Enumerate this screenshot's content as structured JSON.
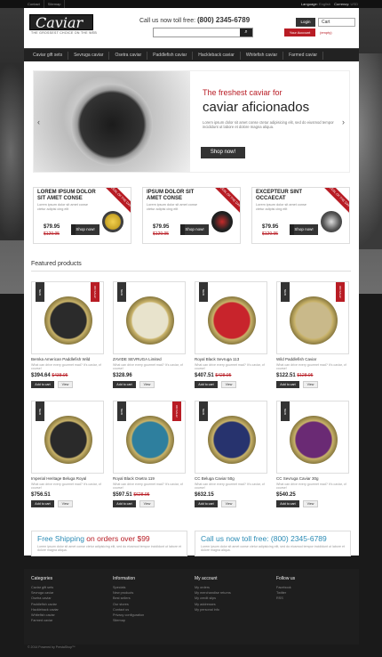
{
  "topbar": {
    "links": [
      "Contact",
      "Sitemap"
    ],
    "language_label": "Language:",
    "language_value": "English",
    "currency_label": "Currency:",
    "currency_value": "USD"
  },
  "header": {
    "logo_text": "Caviar",
    "logo_tagline": "THE GROSSEST CHOICE ON THE WEB",
    "call_label": "Call us now toll free:",
    "call_number": "(800) 2345-6789",
    "search_placeholder": "",
    "login_label": "Login",
    "my_account_label": "Your Account",
    "cart_label": "Cart",
    "cart_status": "(empty)"
  },
  "nav": {
    "items": [
      "Caviar gift sets",
      "Sevruga caviar",
      "Osetra caviar",
      "Paddlefish caviar",
      "Hackleback caviar",
      "Whitefish caviar",
      "Farmed caviar"
    ]
  },
  "slider": {
    "title_line1": "The freshest caviar for",
    "title_line2": "caviar aficionados",
    "text": "Lorem ipsum dolor sit amet conse ctetur adipisicing elit, sed do eiusmod tempor incididunt ut labore et dolore magna aliqua.",
    "button": "Shop now!",
    "prev": "‹",
    "next": "›"
  },
  "deals": [
    {
      "title": "LOREM IPSUM DOLOR SIT AMET CONSE",
      "desc": "Lorem ipsum dolor sit amet conse ctetur adipisi cing elit",
      "price": "$79.95",
      "old_price": "$129.95",
      "button": "Shop now!",
      "ribbon": "DEAL OF THE DAY"
    },
    {
      "title": "IPSUM DOLOR SIT AMET CONSE",
      "desc": "Lorem ipsum dolor sit amet conse ctetur adipisi cing elit",
      "price": "$79.95",
      "old_price": "$129.95",
      "button": "Shop now!",
      "ribbon": "DEAL OF THE DAY"
    },
    {
      "title": "EXCEPTEUR SINT OCCAECAT",
      "desc": "Lorem ipsum dolor sit amet conse ctetur adipisi cing elit",
      "price": "$79.95",
      "old_price": "$129.95",
      "button": "Shop now!",
      "ribbon": "DEAL OF THE DAY"
    }
  ],
  "featured": {
    "heading": "Featured products",
    "products": [
      {
        "name": "Bemka American Paddlefish Wild",
        "desc": "What can drive every gourmet mad? It's caviar, of course!",
        "price": "$394.64",
        "old_price": "$438.95",
        "add": "Add to cart",
        "view": "View",
        "badge": "NEW",
        "sale": "ON SALE!",
        "color": "#2b2b2b"
      },
      {
        "name": "ZAVIDE SEVRUGA Limited",
        "desc": "What can drive every gourmet mad? It's caviar, of course!",
        "price": "$328.96",
        "old_price": "",
        "add": "Add to cart",
        "view": "View",
        "badge": "NEW",
        "sale": "",
        "color": "#e8e3cc"
      },
      {
        "name": "Royal Black Sevruga 113",
        "desc": "What can drive every gourmet mad? It's caviar, of course!",
        "price": "$407.51",
        "old_price": "$428.95",
        "add": "Add to cart",
        "view": "View",
        "badge": "NEW",
        "sale": "",
        "color": "#c8242c"
      },
      {
        "name": "Wild Paddlefish Caviar",
        "desc": "What can drive every gourmet mad? It's caviar, of course!",
        "price": "$122.51",
        "old_price": "$128.95",
        "add": "Add to cart",
        "view": "View",
        "badge": "NEW",
        "sale": "ON SALE!",
        "color": "#c9b98a"
      },
      {
        "name": "Imperial Heritage Beluga Royal",
        "desc": "What can drive every gourmet mad? It's caviar, of course!",
        "price": "$756.51",
        "old_price": "",
        "add": "Add to cart",
        "view": "View",
        "badge": "NEW",
        "sale": "",
        "color": "#2a2a2a"
      },
      {
        "name": "Royal Black Osetra 119",
        "desc": "What can drive every gourmet mad? It's caviar, of course!",
        "price": "$597.51",
        "old_price": "$628.95",
        "add": "Add to cart",
        "view": "View",
        "badge": "NEW",
        "sale": "ON SALE!",
        "color": "#2e7f9e"
      },
      {
        "name": "CC Beluga Caviar 50g",
        "desc": "What can drive every gourmet mad? It's caviar, of course!",
        "price": "$632.15",
        "old_price": "",
        "add": "Add to cart",
        "view": "View",
        "badge": "NEW",
        "sale": "",
        "color": "#27336e"
      },
      {
        "name": "CC Sevruga Caviar 30g",
        "desc": "What can drive every gourmet mad? It's caviar, of course!",
        "price": "$540.25",
        "old_price": "",
        "add": "Add to cart",
        "view": "View",
        "badge": "NEW",
        "sale": "",
        "color": "#6a2a74"
      }
    ]
  },
  "banners": [
    {
      "title_a": "Free Shipping ",
      "title_b": "on orders over $99",
      "text": "Lorem ipsum dolor sit amet conse ctetur adipisicing elit, sed do eiusmod tempor incididunt ut labore et dolore magna aliqua."
    },
    {
      "title_a": "Call us now toll free: (800) 2345-6789",
      "title_b": "",
      "text": "Lorem ipsum dolor sit amet conse ctetur adipisicing elit, sed do eiusmod tempor incididunt ut labore et dolore magna aliqua."
    }
  ],
  "footer": {
    "columns": [
      {
        "heading": "Categories",
        "items": [
          "Caviar gift sets",
          "Sevruga caviar",
          "Osetra caviar",
          "Paddlefish caviar",
          "Hackleback caviar",
          "Whitefish caviar",
          "Farmed caviar"
        ]
      },
      {
        "heading": "Information",
        "items": [
          "Specials",
          "New products",
          "Best sellers",
          "Our stores",
          "Contact us",
          "Privacy configuration",
          "Sitemap"
        ]
      },
      {
        "heading": "My account",
        "items": [
          "My orders",
          "My merchandise returns",
          "My credit slips",
          "My addresses",
          "My personal info"
        ]
      },
      {
        "heading": "Follow us",
        "items": [
          "Facebook",
          "Twitter",
          "RSS"
        ]
      }
    ],
    "copyright": "© 2014 Powered by PrestaShop™"
  }
}
